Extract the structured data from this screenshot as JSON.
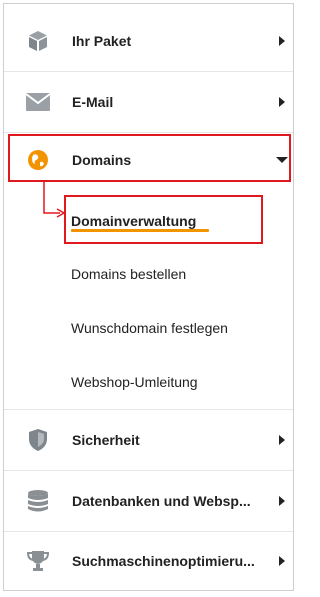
{
  "menu": {
    "items": [
      {
        "label": "Ihr Paket",
        "icon": "package-icon"
      },
      {
        "label": "E-Mail",
        "icon": "envelope-icon"
      },
      {
        "label": "Domains",
        "icon": "globe-icon"
      },
      {
        "label": "Sicherheit",
        "icon": "shield-icon"
      },
      {
        "label": "Datenbanken und Websp...",
        "icon": "database-icon"
      },
      {
        "label": "Suchmaschinenoptimieru...",
        "icon": "trophy-icon"
      }
    ],
    "subitems": [
      {
        "label": "Domainverwaltung"
      },
      {
        "label": "Domains bestellen"
      },
      {
        "label": "Wunschdomain festlegen"
      },
      {
        "label": "Webshop-Umleitung"
      }
    ]
  },
  "colors": {
    "highlight": "#e0191f",
    "accent": "#f29400",
    "icon": "#8a8f94",
    "text": "#222222"
  }
}
